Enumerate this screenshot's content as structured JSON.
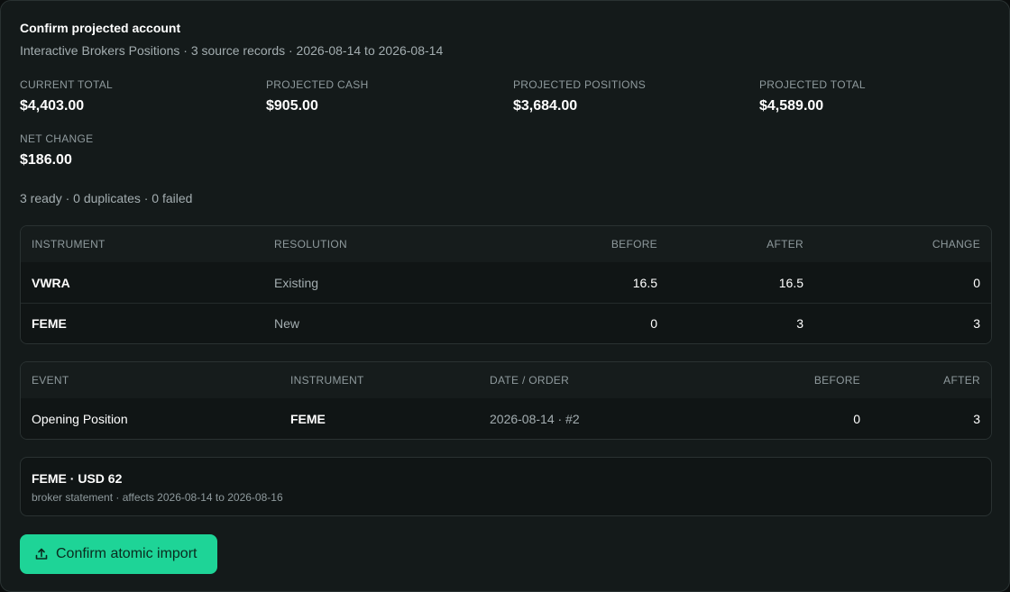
{
  "header": {
    "title": "Confirm projected account",
    "subtitle": "Interactive Brokers Positions · 3 source records · 2026-08-14 to 2026-08-14"
  },
  "metrics": [
    {
      "label": "CURRENT TOTAL",
      "value": "$4,403.00"
    },
    {
      "label": "PROJECTED CASH",
      "value": "$905.00"
    },
    {
      "label": "PROJECTED POSITIONS",
      "value": "$3,684.00"
    },
    {
      "label": "PROJECTED TOTAL",
      "value": "$4,589.00"
    },
    {
      "label": "NET CHANGE",
      "value": "$186.00"
    }
  ],
  "counts": "3 ready · 0 duplicates · 0 failed",
  "positions_table": {
    "headers": [
      "INSTRUMENT",
      "RESOLUTION",
      "BEFORE",
      "AFTER",
      "CHANGE"
    ],
    "rows": [
      {
        "instrument": "VWRA",
        "resolution": "Existing",
        "before": "16.5",
        "after": "16.5",
        "change": "0"
      },
      {
        "instrument": "FEME",
        "resolution": "New",
        "before": "0",
        "after": "3",
        "change": "3"
      }
    ]
  },
  "events_table": {
    "headers": [
      "EVENT",
      "INSTRUMENT",
      "DATE / ORDER",
      "BEFORE",
      "AFTER"
    ],
    "rows": [
      {
        "event": "Opening Position",
        "instrument": "FEME",
        "date_order": "2026-08-14 · #2",
        "before": "0",
        "after": "3"
      }
    ]
  },
  "note": {
    "title": "FEME · USD 62",
    "subtitle": "broker statement · affects 2026-08-14 to 2026-08-16"
  },
  "action": {
    "confirm_label": "Confirm atomic import",
    "icon": "upload-icon"
  },
  "colors": {
    "accent": "#1ed497",
    "background": "#141a1a",
    "border": "#2a3232"
  }
}
